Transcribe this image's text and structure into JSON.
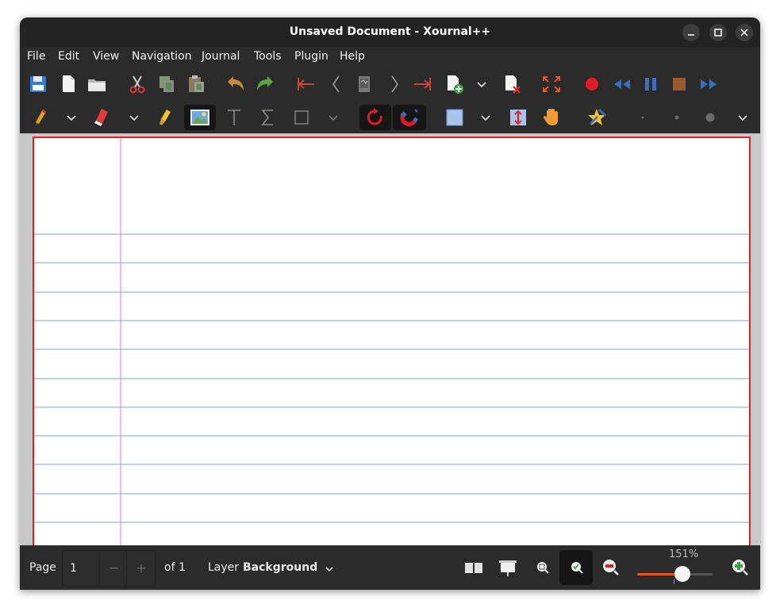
{
  "window": {
    "title": "Unsaved Document - Xournal++"
  },
  "menu": [
    "File",
    "Edit",
    "View",
    "Navigation",
    "Journal",
    "Tools",
    "Plugin",
    "Help"
  ],
  "toolbar1": {
    "icons": [
      "save-icon",
      "new-document-icon",
      "open-folder-icon",
      "cut-icon",
      "copy-icon",
      "paste-icon",
      "undo-icon",
      "redo-icon",
      "first-page-icon",
      "previous-page-icon",
      "goto-page-icon",
      "next-page-icon",
      "last-page-icon",
      "new-page-icon",
      "dropdown-chevron-icon",
      "delete-page-icon",
      "fullscreen-icon",
      "record-icon",
      "rewind-icon",
      "pause-icon",
      "stop-icon",
      "fast-forward-icon"
    ]
  },
  "toolbar2": {
    "icons": [
      "pen-icon",
      "eraser-icon",
      "highlighter-icon",
      "image-icon",
      "text-icon",
      "latex-sigma-icon",
      "shape-rectangle-icon",
      "rotation-snap-icon",
      "grid-snap-magnet-icon",
      "fill-color-icon",
      "vertical-space-icon",
      "hand-icon",
      "default-tools-icon",
      "size-very-fine-icon",
      "size-fine-icon",
      "size-medium-icon"
    ]
  },
  "status": {
    "page_label": "Page",
    "page_value": "1",
    "page_minus": "−",
    "page_plus": "+",
    "of_label": "of 1",
    "layer_label": "Layer",
    "layer_value": "Background",
    "zoom_percent": "151%",
    "zoom_fraction": 0.6
  },
  "colors": {
    "accent": "#e95420",
    "page_border": "#e31c1c",
    "ruled_line": "#7aa3d8",
    "margin_line": "#e07dc3"
  }
}
